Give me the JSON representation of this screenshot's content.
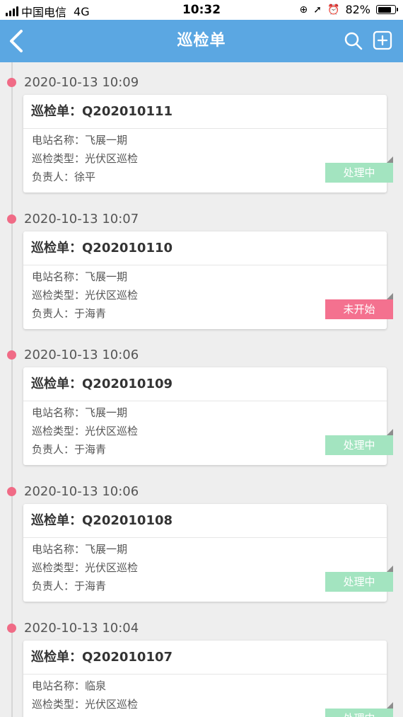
{
  "status_bar": {
    "carrier": "中国电信",
    "network": "4G",
    "time": "10:32",
    "battery": "82%",
    "battery_level": 0.82
  },
  "nav": {
    "title": "巡检单",
    "icons": [
      "back-chevron-icon",
      "search-icon",
      "add-square-icon"
    ]
  },
  "labels": {
    "order": "巡检单：",
    "station": "电站名称：",
    "type": "巡检类型：",
    "owner": "负责人："
  },
  "colors": {
    "nav_bg": "#5ba7e2",
    "timeline_dot": "#f06b86",
    "status_processing": "#a3e4c0",
    "status_not_started": "#f4718f"
  },
  "orders": [
    {
      "date": "2020-10-13 10:09",
      "code": "Q202010111",
      "station": "飞展一期",
      "type": "光伏区巡检",
      "owner": "徐平",
      "status": "处理中"
    },
    {
      "date": "2020-10-13 10:07",
      "code": "Q202010110",
      "station": "飞展一期",
      "type": "光伏区巡检",
      "owner": "于海青",
      "status": "未开始"
    },
    {
      "date": "2020-10-13 10:06",
      "code": "Q202010109",
      "station": "飞展一期",
      "type": "光伏区巡检",
      "owner": "于海青",
      "status": "处理中"
    },
    {
      "date": "2020-10-13 10:06",
      "code": "Q202010108",
      "station": "飞展一期",
      "type": "光伏区巡检",
      "owner": "于海青",
      "status": "处理中"
    },
    {
      "date": "2020-10-13 10:04",
      "code": "Q202010107",
      "station": "临泉",
      "type": "光伏区巡检",
      "owner": "",
      "status": "处理中"
    }
  ]
}
